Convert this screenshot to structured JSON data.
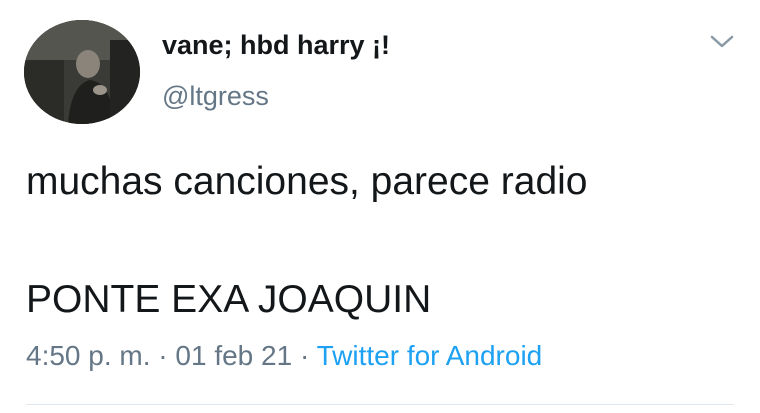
{
  "tweet": {
    "display_name": "vane; hbd harry ¡!",
    "handle": "@ltgress",
    "text_line1": "muchas canciones, parece radio",
    "text_line2": "PONTE EXA JOAQUIN",
    "time": "4:50 p. m.",
    "separator": " · ",
    "date": "01 feb 21",
    "source": "Twitter for Android",
    "avatar_icon": "profile-photo",
    "menu_icon": "chevron-down-icon"
  },
  "colors": {
    "text": "#14171a",
    "secondary": "#657786",
    "link": "#1da1f2",
    "divider": "#e1e8ed"
  }
}
